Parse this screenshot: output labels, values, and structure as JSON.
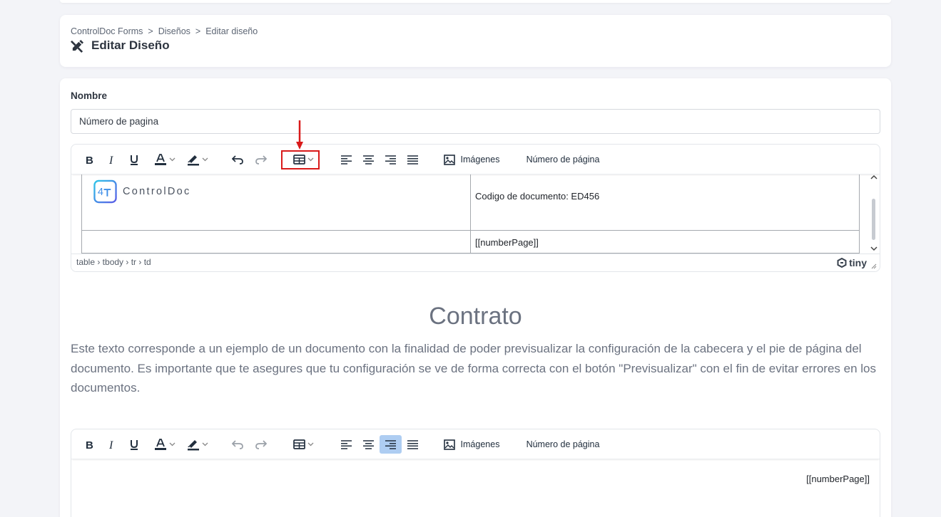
{
  "breadcrumb": {
    "items": [
      "ControlDoc Forms",
      "Diseños",
      "Editar diseño"
    ],
    "sep": ">"
  },
  "page": {
    "title": "Editar Diseño"
  },
  "form": {
    "name_label": "Nombre",
    "name_value": "Número de pagina"
  },
  "toolbar": {
    "images_label": "Imágenes",
    "page_number_label": "Número de página"
  },
  "header_editor": {
    "logo_text": "ControlDoc",
    "logo_mark": "4T",
    "doc_code": "Codigo de documento: ED456",
    "number_page": "[[numberPage]]",
    "path": "table › tbody › tr › td",
    "brand": "tiny"
  },
  "document": {
    "title": "Contrato",
    "body": "Este texto corresponde a un ejemplo de un documento con la finalidad de poder previsualizar la configuración de la cabecera y el pie de página del documento. Es importante que te asegures que tu configuración se ve de forma correcta con el botón \"Previsualizar\" con el fin de evitar errores en los documentos."
  },
  "footer_editor": {
    "number_page": "[[numberPage]]"
  },
  "colors": {
    "highlight": "#d91a1a",
    "active_button": "#aecdf2",
    "logo_gradient_start": "#2fc5e8",
    "logo_gradient_end": "#5b5de6"
  },
  "icons": [
    "pen-ruler-icon",
    "bold-icon",
    "italic-icon",
    "underline-icon",
    "text-color-icon",
    "highlight-icon",
    "undo-icon",
    "redo-icon",
    "table-icon",
    "align-left-icon",
    "align-center-icon",
    "align-right-icon",
    "justify-icon",
    "image-icon"
  ]
}
